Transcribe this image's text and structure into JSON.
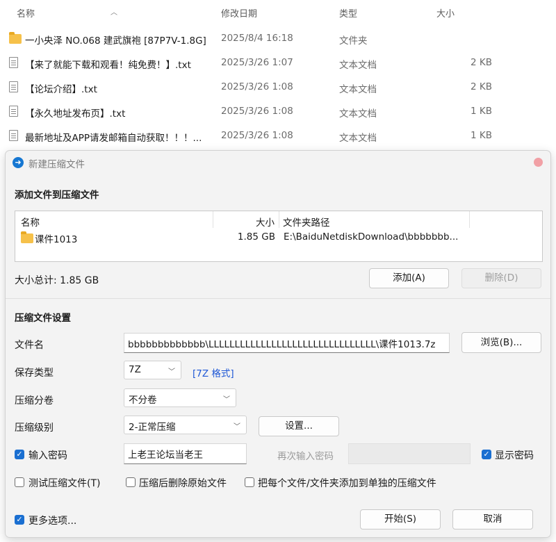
{
  "explorer": {
    "columns": {
      "name": "名称",
      "date": "修改日期",
      "type": "类型",
      "size": "大小"
    },
    "rows": [
      {
        "icon": "folder-icon",
        "name": "一小央泽 NO.068 建武旗袍 [87P7V-1.8G]",
        "date": "2025/8/4 16:18",
        "type": "文件夹",
        "size": ""
      },
      {
        "icon": "text-file-icon",
        "name": "【来了就能下载和观看！纯免费！】.txt",
        "date": "2025/3/26 1:07",
        "type": "文本文档",
        "size": "2 KB"
      },
      {
        "icon": "text-file-icon",
        "name": "【论坛介绍】.txt",
        "date": "2025/3/26 1:08",
        "type": "文本文档",
        "size": "2 KB"
      },
      {
        "icon": "text-file-icon",
        "name": "【永久地址发布页】.txt",
        "date": "2025/3/26 1:08",
        "type": "文本文档",
        "size": "1 KB"
      },
      {
        "icon": "text-file-icon",
        "name": "最新地址及APP请发邮箱自动获取！！！...",
        "date": "2025/3/26 1:08",
        "type": "文本文档",
        "size": "1 KB"
      }
    ]
  },
  "dialog": {
    "title": "新建压缩文件",
    "add_section_title": "添加文件到压缩文件",
    "file_list": {
      "headers": {
        "name": "名称",
        "size": "大小",
        "path": "文件夹路径"
      },
      "rows": [
        {
          "name": "课件1013",
          "size": "1.85 GB",
          "path": "E:\\BaiduNetdiskDownload\\bbbbbbb..."
        }
      ]
    },
    "total_size": "大小总计: 1.85 GB",
    "add_button": "添加(A)",
    "delete_button": "删除(D)",
    "settings_section_title": "压缩文件设置",
    "filename_label": "文件名",
    "filename_value": "bbbbbbbbbbbbb\\LLLLLLLLLLLLLLLLLLLLLLLLLLLLLLLL\\课件1013.7z",
    "browse_button": "浏览(B)...",
    "save_type_label": "保存类型",
    "save_type_value": "7Z",
    "format_link": "[7Z 格式]",
    "split_label": "压缩分卷",
    "split_value": "不分卷",
    "level_label": "压缩级别",
    "level_value": "2-正常压缩",
    "settings_button": "设置...",
    "password_checkbox_label": "输入密码",
    "password_value": "上老王论坛当老王",
    "password_confirm_placeholder": "再次输入密码",
    "show_password_label": "显示密码",
    "test_archive_label": "测试压缩文件(T)",
    "delete_after_label": "压缩后删除原始文件",
    "separate_archives_label": "把每个文件/文件夹添加到单独的压缩文件",
    "more_options_label": "更多选项...",
    "start_button": "开始(S)",
    "cancel_button": "取消",
    "checkboxes": {
      "password": true,
      "show_password": true,
      "test_archive": false,
      "delete_after": false,
      "separate_archives": false,
      "more_options": true
    }
  }
}
